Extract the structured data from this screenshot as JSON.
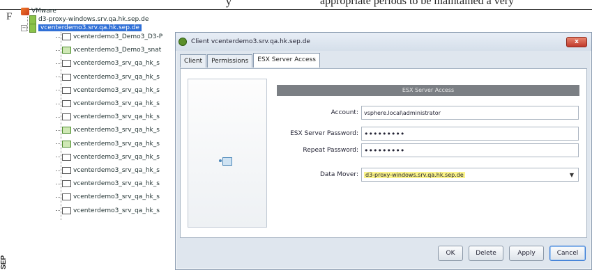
{
  "document": {
    "fragment_right": "appropriate periods to be maintained a very",
    "fragment_mid": "y",
    "fragment_left": "F",
    "side_label": "SEP"
  },
  "tree": {
    "root_label": "VMware",
    "proxy_label": "d3-proxy-windows.srv.qa.hk.sep.de",
    "selected_label": "vcenterdemo3.srv.qa.hk.sep.de",
    "vms": [
      {
        "label": "vcenterdemo3_Demo3_D3-P",
        "green": false
      },
      {
        "label": "vcenterdemo3_Demo3_snat",
        "green": true
      },
      {
        "label": "vcenterdemo3_srv_qa_hk_s",
        "green": false
      },
      {
        "label": "vcenterdemo3_srv_qa_hk_s",
        "green": false
      },
      {
        "label": "vcenterdemo3_srv_qa_hk_s",
        "green": false
      },
      {
        "label": "vcenterdemo3_srv_qa_hk_s",
        "green": false
      },
      {
        "label": "vcenterdemo3_srv_qa_hk_s",
        "green": false
      },
      {
        "label": "vcenterdemo3_srv_qa_hk_s",
        "green": true
      },
      {
        "label": "vcenterdemo3_srv_qa_hk_s",
        "green": true
      },
      {
        "label": "vcenterdemo3_srv_qa_hk_s",
        "green": false
      },
      {
        "label": "vcenterdemo3_srv_qa_hk_s",
        "green": false
      },
      {
        "label": "vcenterdemo3_srv_qa_hk_s",
        "green": false
      },
      {
        "label": "vcenterdemo3_srv_qa_hk_s",
        "green": false
      },
      {
        "label": "vcenterdemo3_srv_qa_hk_s",
        "green": false
      }
    ]
  },
  "dialog": {
    "title": "Client vcenterdemo3.srv.qa.hk.sep.de",
    "close_label": "x",
    "tabs": [
      {
        "label": "Client",
        "active": false
      },
      {
        "label": "Permissions",
        "active": false
      },
      {
        "label": "ESX Server Access",
        "active": true
      }
    ],
    "section_header": "ESX Server Access",
    "fields": {
      "account": {
        "label": "Account:",
        "value": "vsphere.local\\administrator"
      },
      "password": {
        "label": "ESX Server Password:",
        "value": "•••••••••"
      },
      "repeat": {
        "label": "Repeat Password:",
        "value": "•••••••••"
      },
      "data_mover": {
        "label": "Data Mover:",
        "value": "d3-proxy-windows.srv.qa.hk.sep.de"
      }
    },
    "buttons": {
      "ok": "OK",
      "delete": "Delete",
      "apply": "Apply",
      "cancel": "Cancel"
    }
  },
  "colors": {
    "selection": "#2f6fd6",
    "header_bar": "#7b7f84",
    "highlight": "#fbf48a",
    "close_button": "#c0392b"
  }
}
